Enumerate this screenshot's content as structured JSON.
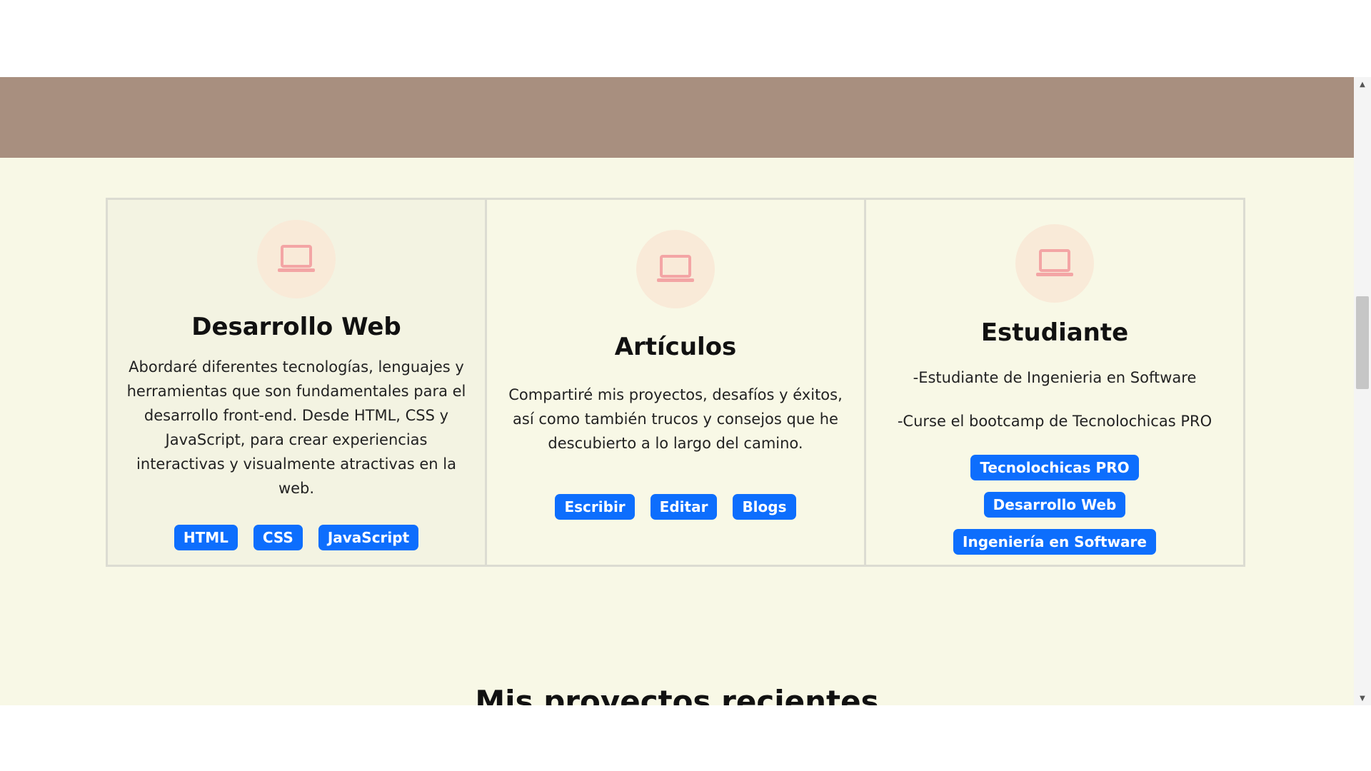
{
  "cards": [
    {
      "icon": "laptop-icon",
      "title": "Desarrollo Web",
      "paragraphs": [
        "Abordaré diferentes tecnologías, lenguajes y herramientas que son fundamentales para el desarrollo front-end. Desde HTML, CSS y JavaScript, para crear experiencias interactivas y visualmente atractivas en la web."
      ],
      "tags": [
        "HTML",
        "CSS",
        "JavaScript"
      ]
    },
    {
      "icon": "laptop-icon",
      "title": "Artículos",
      "paragraphs": [
        "Compartiré mis proyectos, desafíos y éxitos, así como también trucos y consejos que he descubierto a lo largo del camino."
      ],
      "tags": [
        "Escribir",
        "Editar",
        "Blogs"
      ]
    },
    {
      "icon": "laptop-icon",
      "title": "Estudiante",
      "paragraphs": [
        "-Estudiante de Ingenieria en Software",
        "-Curse el bootcamp de Tecnolochicas PRO"
      ],
      "tags": [
        "Tecnolochicas PRO",
        "Desarrollo Web",
        "Ingeniería en Software"
      ]
    }
  ],
  "next_section_title": "Mis proyectos recientes",
  "colors": {
    "hero_band": "#a88f7f",
    "page_background": "#f8f8e6",
    "tag_background": "#0d6efd",
    "icon_circle": "#f9ead8",
    "icon_stroke": "#f3a5a5"
  }
}
